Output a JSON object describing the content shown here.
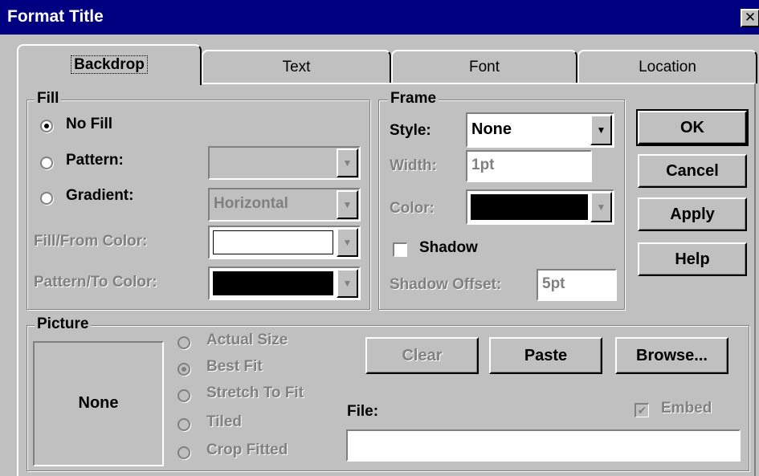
{
  "window": {
    "title": "Format Title",
    "close_glyph": "✕"
  },
  "tabs": [
    {
      "label": "Backdrop",
      "active": true
    },
    {
      "label": "Text",
      "active": false
    },
    {
      "label": "Font",
      "active": false
    },
    {
      "label": "Location",
      "active": false
    }
  ],
  "fill": {
    "group_label": "Fill",
    "no_fill_label": "No Fill",
    "pattern_label": "Pattern:",
    "gradient_label": "Gradient:",
    "gradient_value": "Horizontal",
    "pattern_value": "",
    "selected": "No Fill",
    "fill_from_label": "Fill/From Color:",
    "pattern_to_label": "Pattern/To Color:",
    "fill_from_color": "#ffffff",
    "pattern_to_color": "#000000"
  },
  "frame": {
    "group_label": "Frame",
    "style_label": "Style:",
    "style_value": "None",
    "width_label": "Width:",
    "width_value": "1pt",
    "color_label": "Color:",
    "color_value": "#000000",
    "shadow_label": "Shadow",
    "shadow_checked": false,
    "shadow_offset_label": "Shadow Offset:",
    "shadow_offset_value": "5pt"
  },
  "buttons": {
    "ok": "OK",
    "cancel": "Cancel",
    "apply": "Apply",
    "help": "Help"
  },
  "picture": {
    "group_label": "Picture",
    "preview_text": "None",
    "options": [
      "Actual Size",
      "Best Fit",
      "Stretch To Fit",
      "Tiled",
      "Crop Fitted"
    ],
    "selected": "Best Fit",
    "clear_label": "Clear",
    "paste_label": "Paste",
    "browse_label": "Browse...",
    "file_label": "File:",
    "file_value": "",
    "embed_label": "Embed",
    "embed_checked": true
  }
}
